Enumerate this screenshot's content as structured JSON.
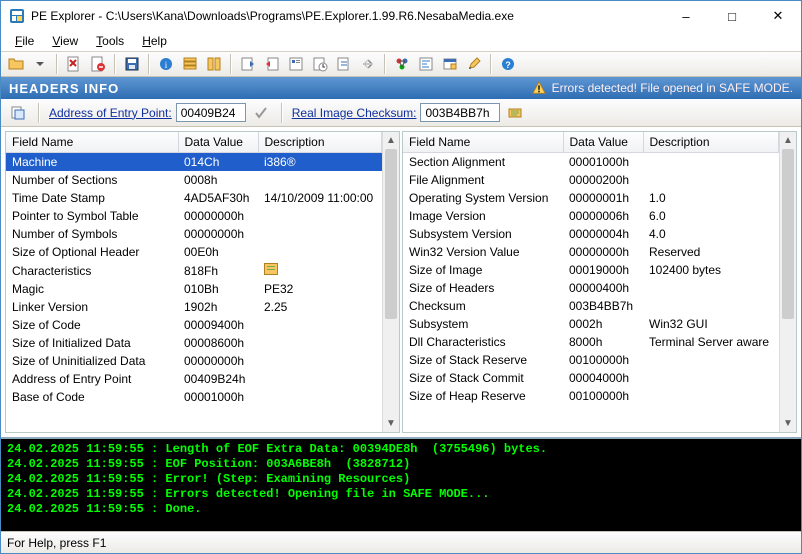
{
  "window": {
    "title": "PE Explorer - C:\\Users\\Kana\\Downloads\\Programs\\PE.Explorer.1.99.R6.NesabaMedia.exe"
  },
  "menu": {
    "file": "File",
    "view": "View",
    "tools": "Tools",
    "help": "Help"
  },
  "header_info": {
    "title": "HEADERS INFO",
    "warning": "Errors detected! File opened in SAFE MODE."
  },
  "subtool": {
    "entry_label": "Address of Entry Point:",
    "entry_value": "00409B24",
    "checksum_label": "Real Image Checksum:",
    "checksum_value": "003B4BB7h"
  },
  "columns": {
    "field": "Field Name",
    "value": "Data Value",
    "desc": "Description"
  },
  "left_rows": [
    {
      "field": "Machine",
      "value": "014Ch",
      "desc": "i386®",
      "selected": true
    },
    {
      "field": "Number of Sections",
      "value": "0008h",
      "desc": ""
    },
    {
      "field": "Time Date Stamp",
      "value": "4AD5AF30h",
      "desc": "14/10/2009  11:00:00"
    },
    {
      "field": "Pointer to Symbol Table",
      "value": "00000000h",
      "desc": ""
    },
    {
      "field": "Number of Symbols",
      "value": "00000000h",
      "desc": ""
    },
    {
      "field": "Size of Optional Header",
      "value": "00E0h",
      "desc": ""
    },
    {
      "field": "Characteristics",
      "value": "818Fh",
      "desc": "📋",
      "desc_is_icon": true
    },
    {
      "field": "Magic",
      "value": "010Bh",
      "desc": "PE32"
    },
    {
      "field": "Linker Version",
      "value": "1902h",
      "desc": "2.25"
    },
    {
      "field": "Size of Code",
      "value": "00009400h",
      "desc": ""
    },
    {
      "field": "Size of Initialized Data",
      "value": "00008600h",
      "desc": ""
    },
    {
      "field": "Size of Uninitialized Data",
      "value": "00000000h",
      "desc": ""
    },
    {
      "field": "Address of Entry Point",
      "value": "00409B24h",
      "desc": ""
    },
    {
      "field": "Base of Code",
      "value": "00001000h",
      "desc": ""
    }
  ],
  "right_rows": [
    {
      "field": "Section Alignment",
      "value": "00001000h",
      "desc": ""
    },
    {
      "field": "File Alignment",
      "value": "00000200h",
      "desc": ""
    },
    {
      "field": "Operating System Version",
      "value": "00000001h",
      "desc": "1.0"
    },
    {
      "field": "Image Version",
      "value": "00000006h",
      "desc": "6.0"
    },
    {
      "field": "Subsystem Version",
      "value": "00000004h",
      "desc": "4.0"
    },
    {
      "field": "Win32 Version Value",
      "value": "00000000h",
      "desc": "Reserved"
    },
    {
      "field": "Size of Image",
      "value": "00019000h",
      "desc": "102400 bytes"
    },
    {
      "field": "Size of Headers",
      "value": "00000400h",
      "desc": ""
    },
    {
      "field": "Checksum",
      "value": "003B4BB7h",
      "desc": ""
    },
    {
      "field": "Subsystem",
      "value": "0002h",
      "desc": "Win32 GUI"
    },
    {
      "field": "Dll Characteristics",
      "value": "8000h",
      "desc": "Terminal Server aware"
    },
    {
      "field": "Size of Stack Reserve",
      "value": "00100000h",
      "desc": ""
    },
    {
      "field": "Size of Stack Commit",
      "value": "00004000h",
      "desc": ""
    },
    {
      "field": "Size of Heap Reserve",
      "value": "00100000h",
      "desc": ""
    }
  ],
  "console_lines": [
    "24.02.2025 11:59:55 : Length of EOF Extra Data: 00394DE8h  (3755496) bytes.",
    "24.02.2025 11:59:55 : EOF Position: 003A6BE8h  (3828712)",
    "24.02.2025 11:59:55 : Error! (Step: Examining Resources)",
    "24.02.2025 11:59:55 : Errors detected! Opening file in SAFE MODE...",
    "24.02.2025 11:59:55 : Done."
  ],
  "status": "For Help, press F1"
}
